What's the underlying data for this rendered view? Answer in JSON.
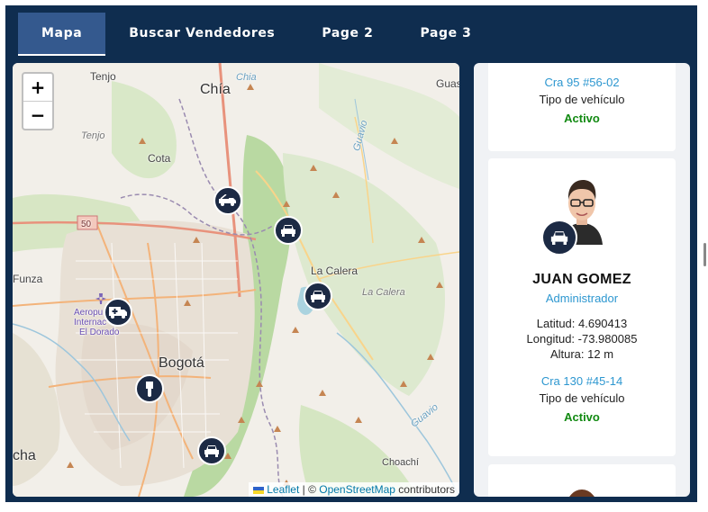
{
  "tabs": [
    {
      "label": "Mapa",
      "active": true
    },
    {
      "label": "Buscar Vendedores",
      "active": false
    },
    {
      "label": "Page 2",
      "active": false
    },
    {
      "label": "Page 3",
      "active": false
    }
  ],
  "map": {
    "zoom_in": "+",
    "zoom_out": "−",
    "places": {
      "chia": "Chía",
      "tenjo": "Tenjo",
      "tenjo_river": "Tenjo",
      "cota": "Cota",
      "guasca": "Guas",
      "la_calera": "La Calera",
      "la_calera_river": "La Calera",
      "funza": "Funza",
      "bogota": "Bogotá",
      "airport_1": "Aeropu",
      "airport_2": "Internac",
      "airport_3": "El Dorado",
      "guavio": "Guavio",
      "guavio_river": "Guavio",
      "chia_river": "Chia",
      "choachi": "Choachí",
      "soacha": "cha",
      "road_50": "50"
    },
    "markers": [
      {
        "icon": "tow-truck-icon"
      },
      {
        "icon": "car-icon"
      },
      {
        "icon": "car-icon"
      },
      {
        "icon": "ambulance-icon"
      },
      {
        "icon": "scooter-icon"
      },
      {
        "icon": "car-icon"
      }
    ],
    "attribution": {
      "leaflet": "Leaflet",
      "separator": " | © ",
      "osm": "OpenStreetMap",
      "suffix": " contributors"
    }
  },
  "cards": [
    {
      "address": "Cra 95 #56-02",
      "vehicle_type": "Tipo de vehículo",
      "status": "Activo"
    },
    {
      "name": "JUAN GOMEZ",
      "role": "Administrador",
      "latitude": "Latitud: 4.690413",
      "longitude": "Longitud: -73.980085",
      "altitude": "Altura: 12 m",
      "address": "Cra 130 #45-14",
      "vehicle_type": "Tipo de vehículo",
      "status": "Activo"
    }
  ],
  "colors": {
    "header_bg": "#0f2d4f",
    "active_tab": "#34598e",
    "link": "#2d97d0",
    "status_active": "#128a12",
    "marker": "#1c2a44"
  }
}
